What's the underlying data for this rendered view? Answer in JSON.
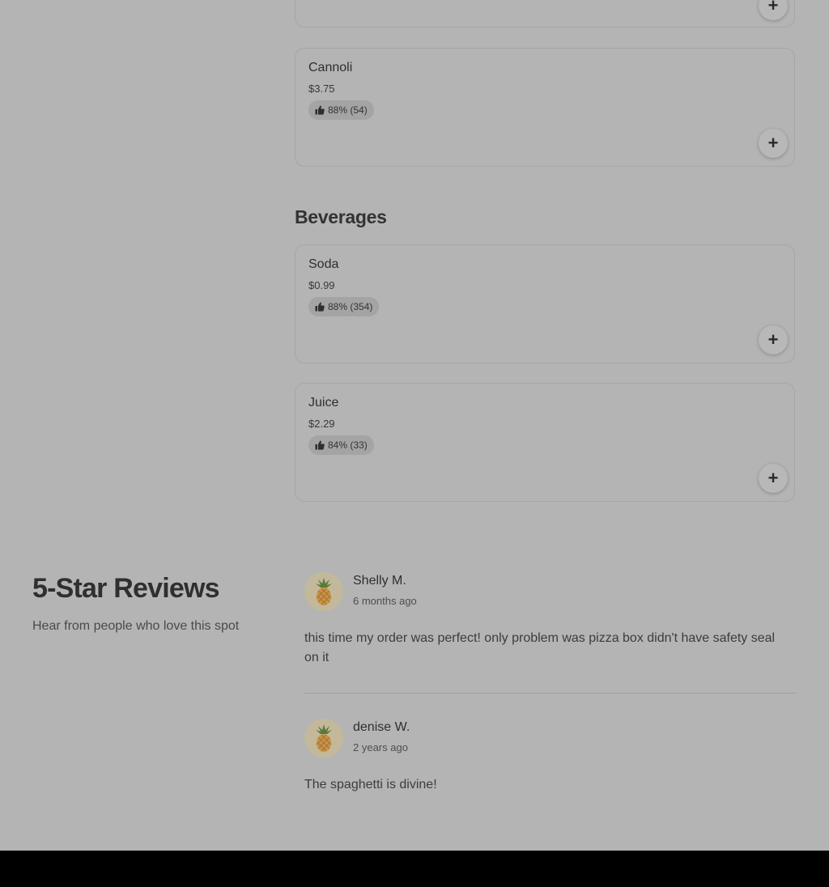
{
  "menu": {
    "beverages_title": "Beverages",
    "items": [
      {
        "name": "Cannoli",
        "price": "$3.75",
        "rating": "88% (54)",
        "add_label": "+"
      },
      {
        "name": "Soda",
        "price": "$0.99",
        "rating": "88% (354)",
        "add_label": "+"
      },
      {
        "name": "Juice",
        "price": "$2.29",
        "rating": "84% (33)",
        "add_label": "+"
      }
    ],
    "top_card_add_label": "+"
  },
  "reviews": {
    "title": "5-Star Reviews",
    "subtitle": "Hear from people who love this spot",
    "list": [
      {
        "name": "Shelly M.",
        "time": "6 months ago",
        "text": "this time my order was perfect! only problem was pizza box didn't have safety seal on it"
      },
      {
        "name": "denise W.",
        "time": "2 years ago",
        "text": "The spaghetti is divine!"
      }
    ]
  }
}
